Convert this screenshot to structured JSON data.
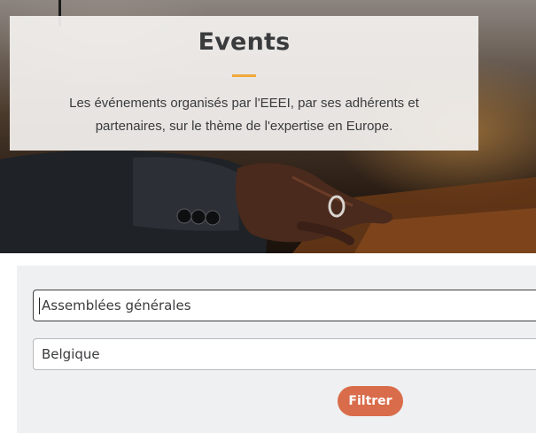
{
  "hero": {
    "title": "Events",
    "description": "Les événements organisés par l'EEEI, par ses adhérents et partenaires, sur le thème de l'expertise en Europe.",
    "accent_color": "#f0a93a"
  },
  "filters": {
    "category_value": "Assemblées générales",
    "country_value": "Belgique",
    "submit_label": "Filtrer",
    "button_color": "#d96c4a"
  }
}
